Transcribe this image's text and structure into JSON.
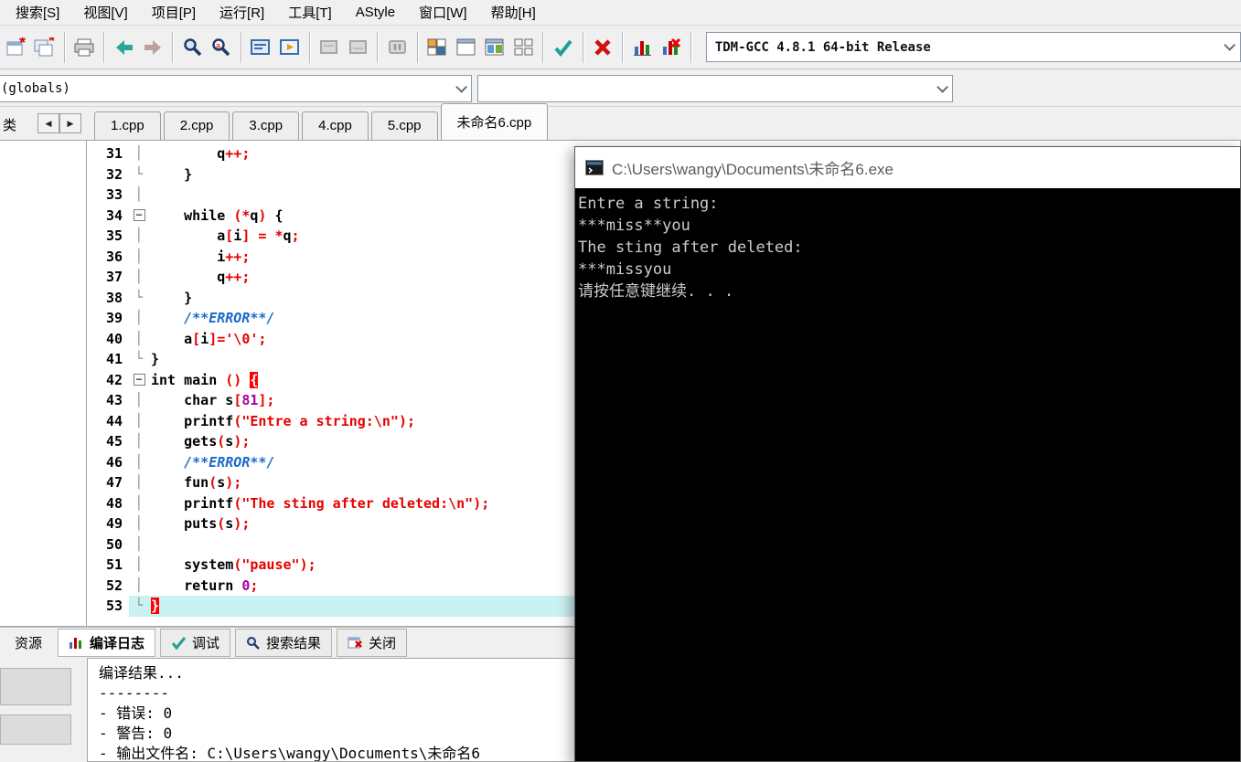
{
  "colors": {
    "chrome": "#f0f0f0",
    "current_line": "#c9f2f2",
    "brace_match": "#ff0000",
    "console_bg": "#000000",
    "console_text": "#cccccc",
    "string_red": "#e60000",
    "number_purple": "#a000a0",
    "comment_blue": "#1b6acb"
  },
  "menu": {
    "items": [
      "搜索[S]",
      "视图[V]",
      "项目[P]",
      "运行[R]",
      "工具[T]",
      "AStyle",
      "窗口[W]",
      "帮助[H]"
    ]
  },
  "toolbar": {
    "compiler": "TDM-GCC 4.8.1 64-bit Release",
    "buttons": [
      "save-icon",
      "save-as-icon",
      "print-icon",
      "undo-icon",
      "redo-icon",
      "find-icon",
      "replace-icon",
      "compile-icon",
      "run-icon",
      "compile-run-icon-disabled",
      "rebuild-icon-disabled",
      "pause-icon-disabled",
      "window-layout-1-icon",
      "window-layout-2-icon",
      "window-layout-3-icon",
      "window-layout-4-icon",
      "syntax-check-icon",
      "abort-icon",
      "profile-icon",
      "profile-delete-icon"
    ]
  },
  "combo_row": {
    "globals": "(globals)",
    "members": ""
  },
  "left_panel": {
    "tab_label": "类"
  },
  "editor_tabs": {
    "items": [
      {
        "label": "1.cpp"
      },
      {
        "label": "2.cpp"
      },
      {
        "label": "3.cpp"
      },
      {
        "label": "4.cpp"
      },
      {
        "label": "5.cpp"
      },
      {
        "label": "未命名6.cpp",
        "active": true
      }
    ]
  },
  "editor": {
    "lines": [
      {
        "n": 31,
        "f": "v",
        "s": [
          [
            "        q",
            "p"
          ],
          [
            "++;",
            "y"
          ]
        ]
      },
      {
        "n": 32,
        "f": "e",
        "s": [
          [
            "    }",
            "p"
          ]
        ]
      },
      {
        "n": 33,
        "f": "v",
        "s": [
          [
            "",
            "p"
          ]
        ]
      },
      {
        "n": 34,
        "f": "m",
        "s": [
          [
            "    ",
            "p"
          ],
          [
            "while",
            "k"
          ],
          [
            " ",
            "p"
          ],
          [
            "(*",
            "y"
          ],
          [
            "q",
            "p"
          ],
          [
            ")",
            "y"
          ],
          [
            " {",
            "p"
          ]
        ]
      },
      {
        "n": 35,
        "f": "v",
        "s": [
          [
            "        a",
            "p"
          ],
          [
            "[",
            "y"
          ],
          [
            "i",
            "p"
          ],
          [
            "]",
            "y"
          ],
          [
            " ",
            "p"
          ],
          [
            "=",
            "y"
          ],
          [
            " ",
            "p"
          ],
          [
            "*",
            "y"
          ],
          [
            "q",
            "p"
          ],
          [
            ";",
            "y"
          ]
        ]
      },
      {
        "n": 36,
        "f": "v",
        "s": [
          [
            "        i",
            "p"
          ],
          [
            "++;",
            "y"
          ]
        ]
      },
      {
        "n": 37,
        "f": "v",
        "s": [
          [
            "        q",
            "p"
          ],
          [
            "++;",
            "y"
          ]
        ]
      },
      {
        "n": 38,
        "f": "e",
        "s": [
          [
            "    }",
            "p"
          ]
        ]
      },
      {
        "n": 39,
        "f": "v",
        "s": [
          [
            "    ",
            "p"
          ],
          [
            "/**ERROR**/",
            "c"
          ]
        ]
      },
      {
        "n": 40,
        "f": "v",
        "s": [
          [
            "    a",
            "p"
          ],
          [
            "[",
            "y"
          ],
          [
            "i",
            "p"
          ],
          [
            "]=",
            "y"
          ],
          [
            "'\\0'",
            "s"
          ],
          [
            ";",
            "y"
          ]
        ]
      },
      {
        "n": 41,
        "f": "e",
        "s": [
          [
            "}",
            "p"
          ]
        ]
      },
      {
        "n": 42,
        "f": "m",
        "s": [
          [
            "int",
            "k"
          ],
          [
            " main ",
            "p"
          ],
          [
            "()",
            "y"
          ],
          [
            " ",
            "p"
          ],
          [
            "{",
            "bh"
          ]
        ]
      },
      {
        "n": 43,
        "f": "v",
        "s": [
          [
            "    ",
            "p"
          ],
          [
            "char",
            "k"
          ],
          [
            " s",
            "p"
          ],
          [
            "[",
            "y"
          ],
          [
            "81",
            "n"
          ],
          [
            "];",
            "y"
          ]
        ]
      },
      {
        "n": 44,
        "f": "v",
        "s": [
          [
            "    printf",
            "p"
          ],
          [
            "(",
            "y"
          ],
          [
            "\"Entre a string:\\n\"",
            "s"
          ],
          [
            ");",
            "y"
          ]
        ]
      },
      {
        "n": 45,
        "f": "v",
        "s": [
          [
            "    gets",
            "p"
          ],
          [
            "(",
            "y"
          ],
          [
            "s",
            "p"
          ],
          [
            ");",
            "y"
          ]
        ]
      },
      {
        "n": 46,
        "f": "v",
        "s": [
          [
            "    ",
            "p"
          ],
          [
            "/**ERROR**/",
            "c"
          ]
        ]
      },
      {
        "n": 47,
        "f": "v",
        "s": [
          [
            "    fun",
            "p"
          ],
          [
            "(",
            "y"
          ],
          [
            "s",
            "p"
          ],
          [
            ");",
            "y"
          ]
        ]
      },
      {
        "n": 48,
        "f": "v",
        "s": [
          [
            "    printf",
            "p"
          ],
          [
            "(",
            "y"
          ],
          [
            "\"The sting after deleted:\\n\"",
            "s"
          ],
          [
            ");",
            "y"
          ]
        ]
      },
      {
        "n": 49,
        "f": "v",
        "s": [
          [
            "    puts",
            "p"
          ],
          [
            "(",
            "y"
          ],
          [
            "s",
            "p"
          ],
          [
            ");",
            "y"
          ]
        ]
      },
      {
        "n": 50,
        "f": "v",
        "s": [
          [
            "",
            "p"
          ]
        ]
      },
      {
        "n": 51,
        "f": "v",
        "s": [
          [
            "    system",
            "p"
          ],
          [
            "(",
            "y"
          ],
          [
            "\"pause\"",
            "s"
          ],
          [
            ");",
            "y"
          ]
        ]
      },
      {
        "n": 52,
        "f": "v",
        "s": [
          [
            "    ",
            "p"
          ],
          [
            "return",
            "k"
          ],
          [
            " ",
            "p"
          ],
          [
            "0",
            "n"
          ],
          [
            ";",
            "y"
          ]
        ]
      },
      {
        "n": 53,
        "f": "e",
        "hl": true,
        "s": [
          [
            "}",
            "bh"
          ]
        ]
      }
    ]
  },
  "console": {
    "title": "C:\\Users\\wangy\\Documents\\未命名6.exe",
    "lines": [
      "Entre a string:",
      "***miss**you",
      "The sting after deleted:",
      "***missyou",
      "请按任意键继续. . ."
    ]
  },
  "bottom_tabs": {
    "items": [
      {
        "label": "资源"
      },
      {
        "label": "编译日志",
        "active": true
      },
      {
        "label": "调试"
      },
      {
        "label": "搜索结果"
      },
      {
        "label": "关闭"
      }
    ]
  },
  "log": {
    "lines": [
      "编译结果...",
      "--------",
      "- 错误: 0",
      "- 警告: 0",
      "- 输出文件名: C:\\Users\\wangy\\Documents\\未命名6"
    ]
  }
}
